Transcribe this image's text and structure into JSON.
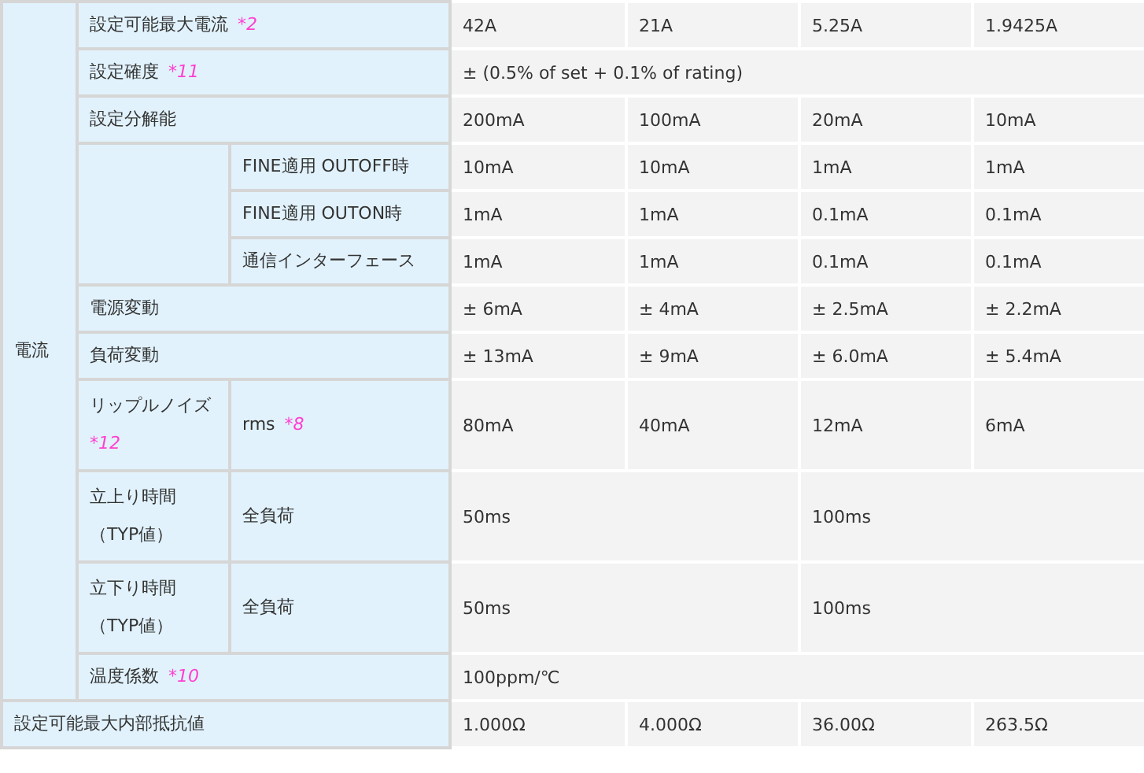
{
  "group": {
    "label": "電流",
    "rows": [
      {
        "label": "設定可能最大電流",
        "note": "*2",
        "values": [
          "42A",
          "21A",
          "5.25A",
          "1.9425A"
        ]
      },
      {
        "label": "設定確度",
        "note": "*11",
        "values": [
          "± (0.5% of set + 0.1% of rating)"
        ]
      },
      {
        "label": "設定分解能",
        "values": [
          "200mA",
          "100mA",
          "20mA",
          "10mA"
        ],
        "children": [
          {
            "sub": "FINE適用 OUTOFF時",
            "values": [
              "10mA",
              "10mA",
              "1mA",
              "1mA"
            ]
          },
          {
            "sub": "FINE適用 OUTON時",
            "values": [
              "1mA",
              "1mA",
              "0.1mA",
              "0.1mA"
            ]
          },
          {
            "sub": "通信インターフェース",
            "values": [
              "1mA",
              "1mA",
              "0.1mA",
              "0.1mA"
            ]
          }
        ]
      },
      {
        "label": "電源変動",
        "values": [
          "± 6mA",
          "± 4mA",
          "± 2.5mA",
          "± 2.2mA"
        ]
      },
      {
        "label": "負荷変動",
        "values": [
          "± 13mA",
          "± 9mA",
          "± 6.0mA",
          "± 5.4mA"
        ]
      },
      {
        "label": "リップルノイズ",
        "note": "*12",
        "sub": "rms",
        "subnote": "*8",
        "values": [
          "80mA",
          "40mA",
          "12mA",
          "6mA"
        ]
      },
      {
        "label": "立上り時間",
        "qualifier": "（TYP値）",
        "sub": "全負荷",
        "values": [
          "50ms",
          "100ms"
        ]
      },
      {
        "label": "立下り時間",
        "qualifier": "（TYP値）",
        "sub": "全負荷",
        "values": [
          "50ms",
          "100ms"
        ]
      },
      {
        "label": "温度係数",
        "note": "*10",
        "values": [
          "100ppm/℃"
        ]
      }
    ]
  },
  "footer_row": {
    "label": "設定可能最大内部抵抗値",
    "values": [
      "1.000Ω",
      "4.000Ω",
      "36.00Ω",
      "263.5Ω"
    ]
  }
}
